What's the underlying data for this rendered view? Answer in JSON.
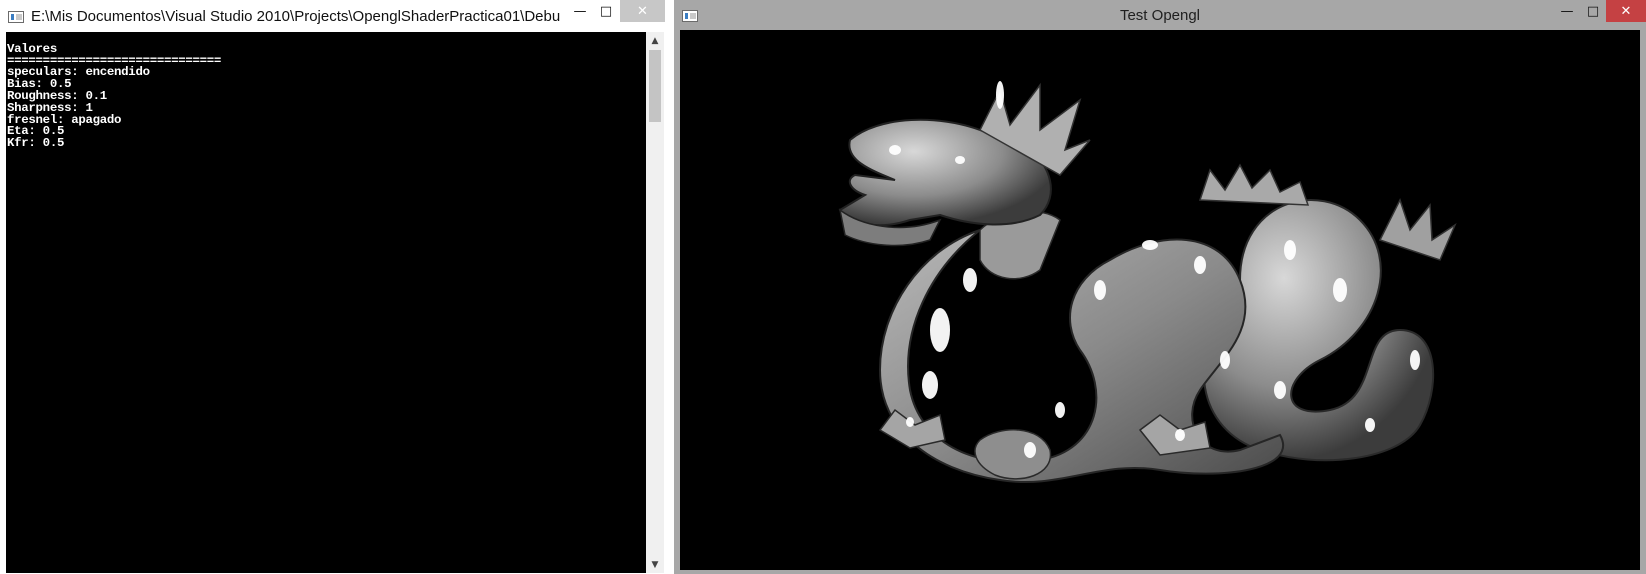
{
  "console": {
    "title": "E:\\Mis Documentos\\Visual Studio 2010\\Projects\\OpenglShaderPractica01\\Debu...",
    "lines": [
      "Valores",
      "==============================",
      "speculars: encendido",
      "Bias: 0.5",
      "Roughness: 0.1",
      "Sharpness: 1",
      "fresnel: apagado",
      "Eta: 0.5",
      "Kfr: 0.5"
    ],
    "scroll_up": "▲",
    "scroll_down": "▼"
  },
  "gl_window": {
    "title": "Test Opengl",
    "scene": "stanford-dragon-render"
  },
  "caption": {
    "minimize": "—",
    "maximize": "□",
    "close": "✕"
  },
  "colors": {
    "console_bg": "#000000",
    "console_text": "#ffffff",
    "close_hover": "#c54143"
  },
  "icons": [
    "console-app-icon",
    "opengl-app-icon",
    "minimize-icon",
    "maximize-icon",
    "close-icon"
  ]
}
